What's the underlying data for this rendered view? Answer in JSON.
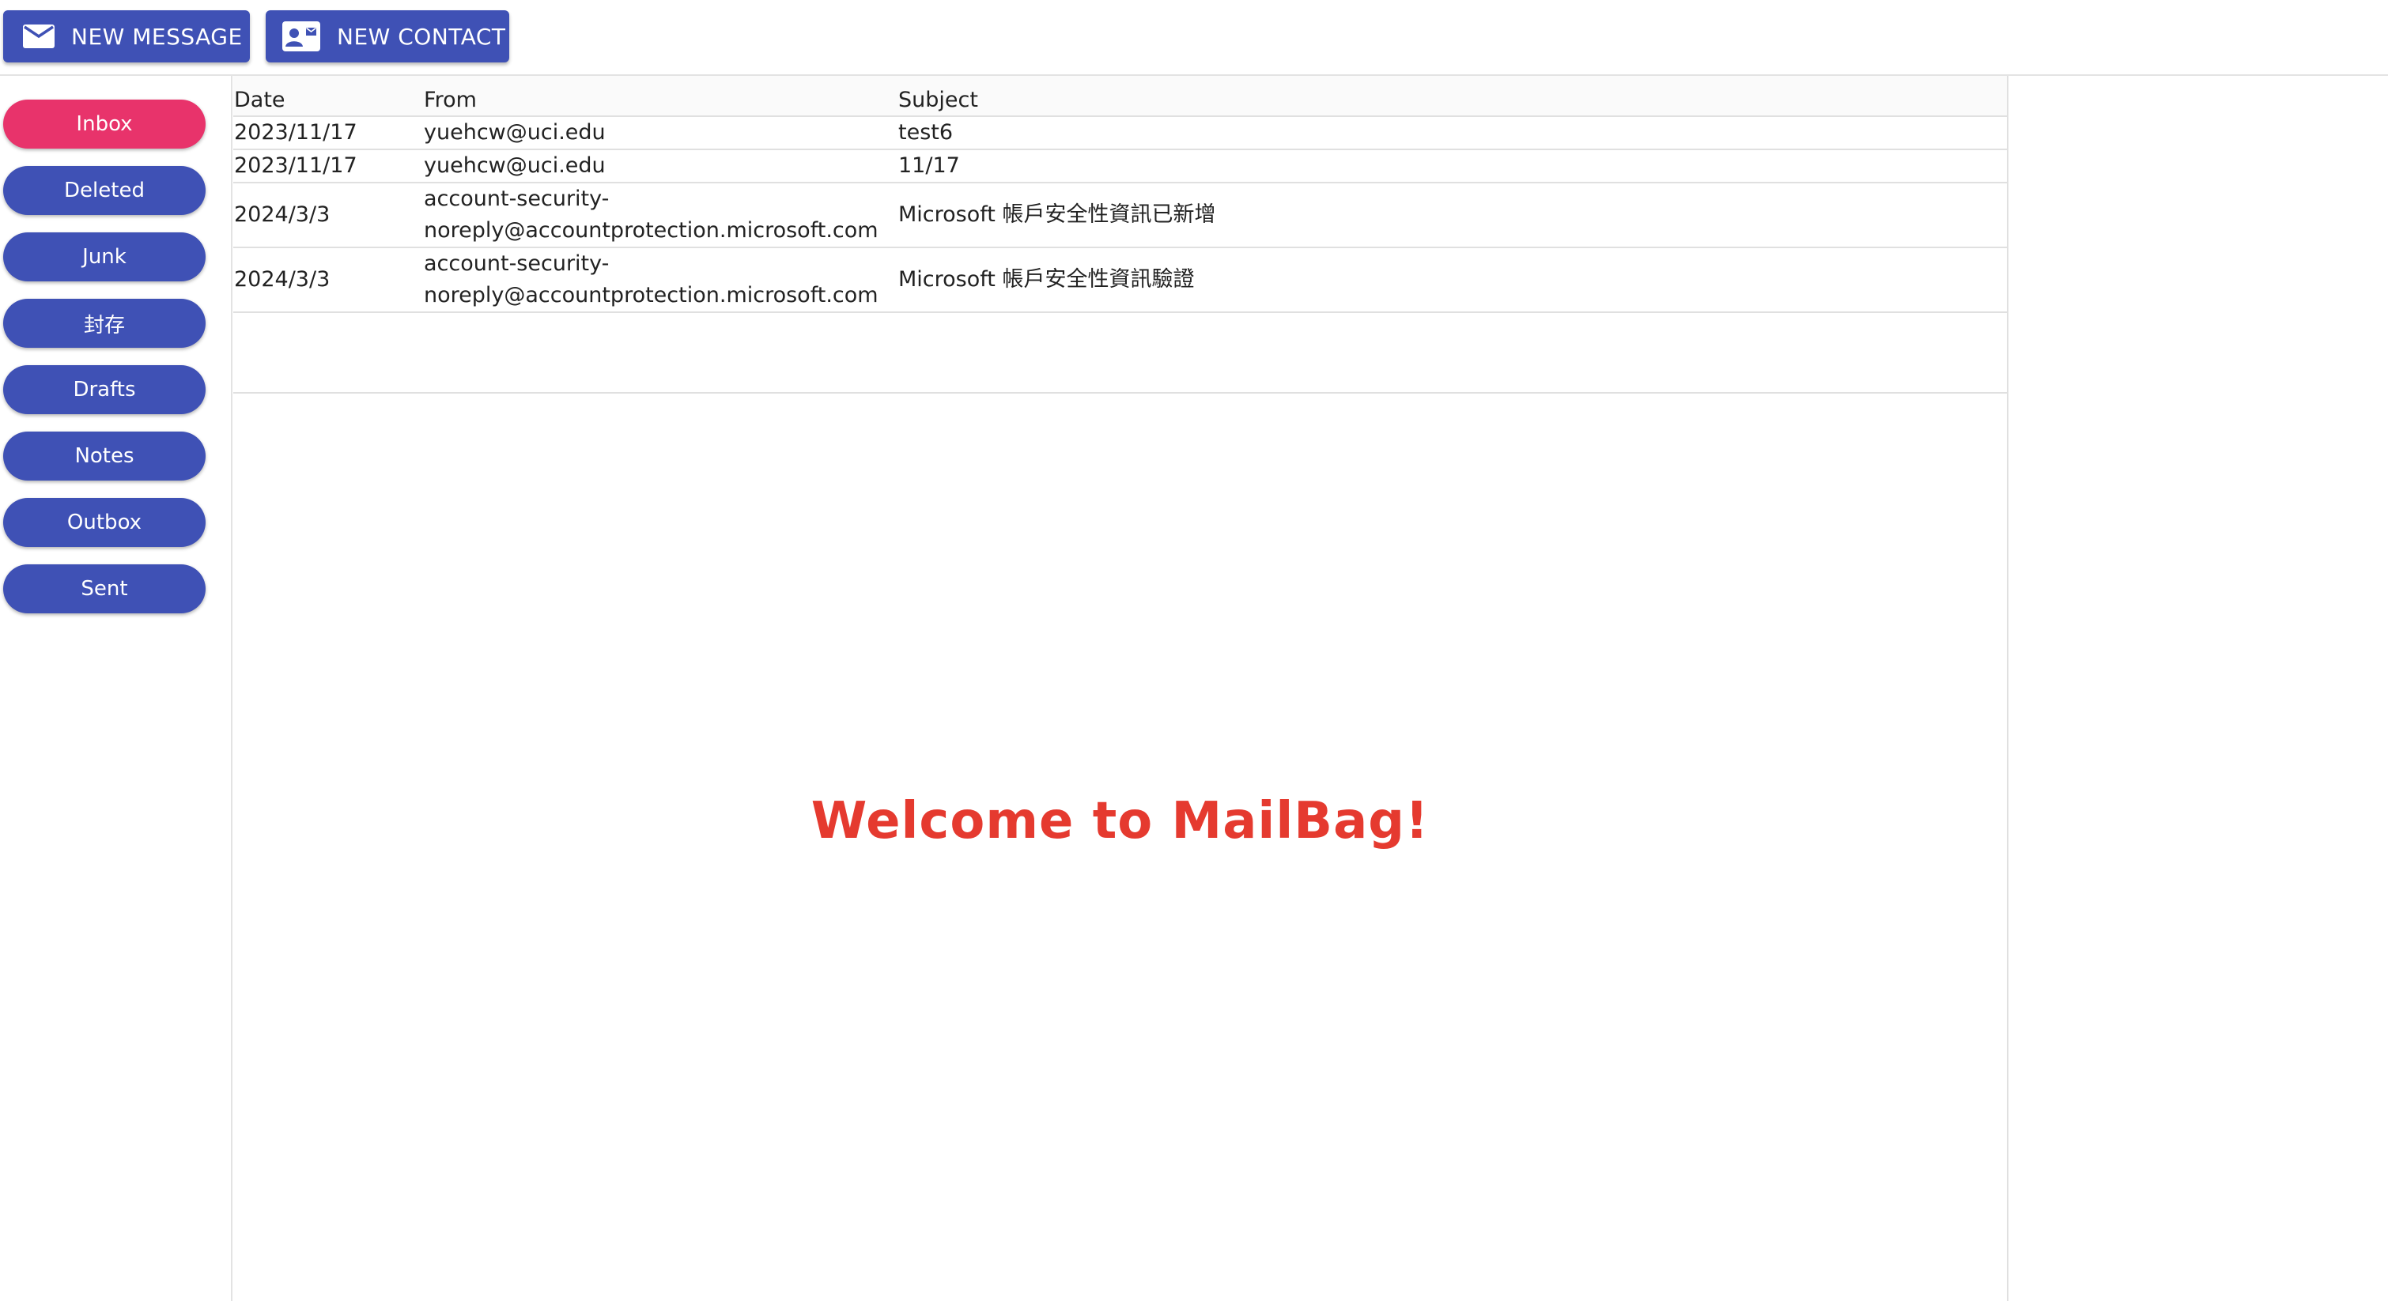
{
  "toolbar": {
    "new_message_label": "NEW MESSAGE",
    "new_contact_label": "NEW CONTACT",
    "new_message_icon": "mail-icon",
    "new_contact_icon": "contact-card-icon"
  },
  "folders": [
    {
      "label": "Inbox",
      "active": true
    },
    {
      "label": "Deleted",
      "active": false
    },
    {
      "label": "Junk",
      "active": false
    },
    {
      "label": "封存",
      "active": false
    },
    {
      "label": "Drafts",
      "active": false
    },
    {
      "label": "Notes",
      "active": false
    },
    {
      "label": "Outbox",
      "active": false
    },
    {
      "label": "Sent",
      "active": false
    }
  ],
  "message_list": {
    "columns": {
      "date": "Date",
      "from": "From",
      "subject": "Subject"
    },
    "rows": [
      {
        "date": "2023/11/17",
        "from_line1": "yuehcw@uci.edu",
        "from_line2": "",
        "subject": "test6"
      },
      {
        "date": "2023/11/17",
        "from_line1": "yuehcw@uci.edu",
        "from_line2": "",
        "subject": "11/17"
      },
      {
        "date": "2024/3/3",
        "from_line1": "account-security-",
        "from_line2": "noreply@accountprotection.microsoft.com",
        "subject": "Microsoft 帳戶安全性資訊已新增"
      },
      {
        "date": "2024/3/3",
        "from_line1": "account-security-",
        "from_line2": "noreply@accountprotection.microsoft.com",
        "subject": "Microsoft 帳戶安全性資訊驗證"
      }
    ]
  },
  "view": {
    "welcome_text": "Welcome to MailBag!"
  },
  "colors": {
    "primary": "#3f51b5",
    "active_folder": "#e8336b",
    "welcome": "#e53a2f"
  }
}
